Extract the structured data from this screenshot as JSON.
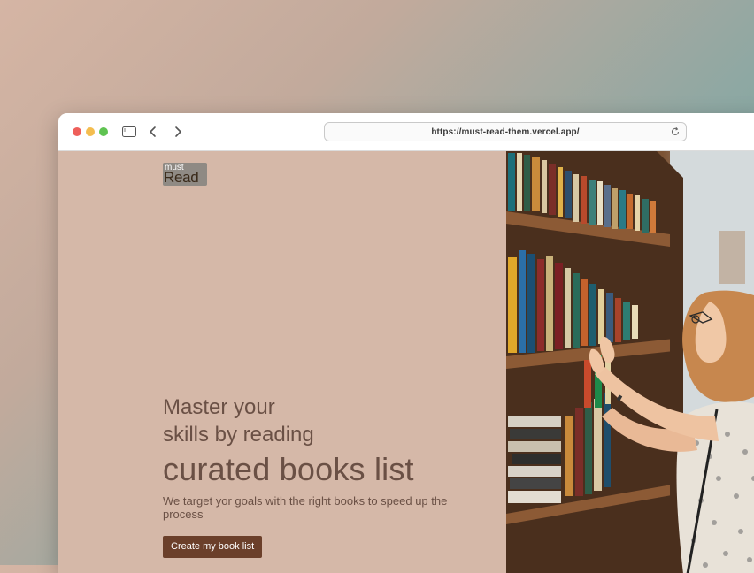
{
  "browser": {
    "url": "https://must-read-them.vercel.app/",
    "icons": [
      "sidebar-icon",
      "back-icon",
      "forward-icon",
      "reload-icon"
    ]
  },
  "logo": {
    "top": "must",
    "main": "Read"
  },
  "hero": {
    "line1": "Master your",
    "line2": "skills by reading",
    "line3": "curated books list",
    "subtitle": "We target yor goals with the right books to speed up the process",
    "cta_label": "Create my book list"
  },
  "colors": {
    "background_panel": "#d5b8a8",
    "heading_text": "#6a5045",
    "cta_background": "#6b3f2a",
    "cta_text": "#ffffff"
  },
  "image": {
    "subject": "woman-browsing-library-bookshelf-photo"
  }
}
